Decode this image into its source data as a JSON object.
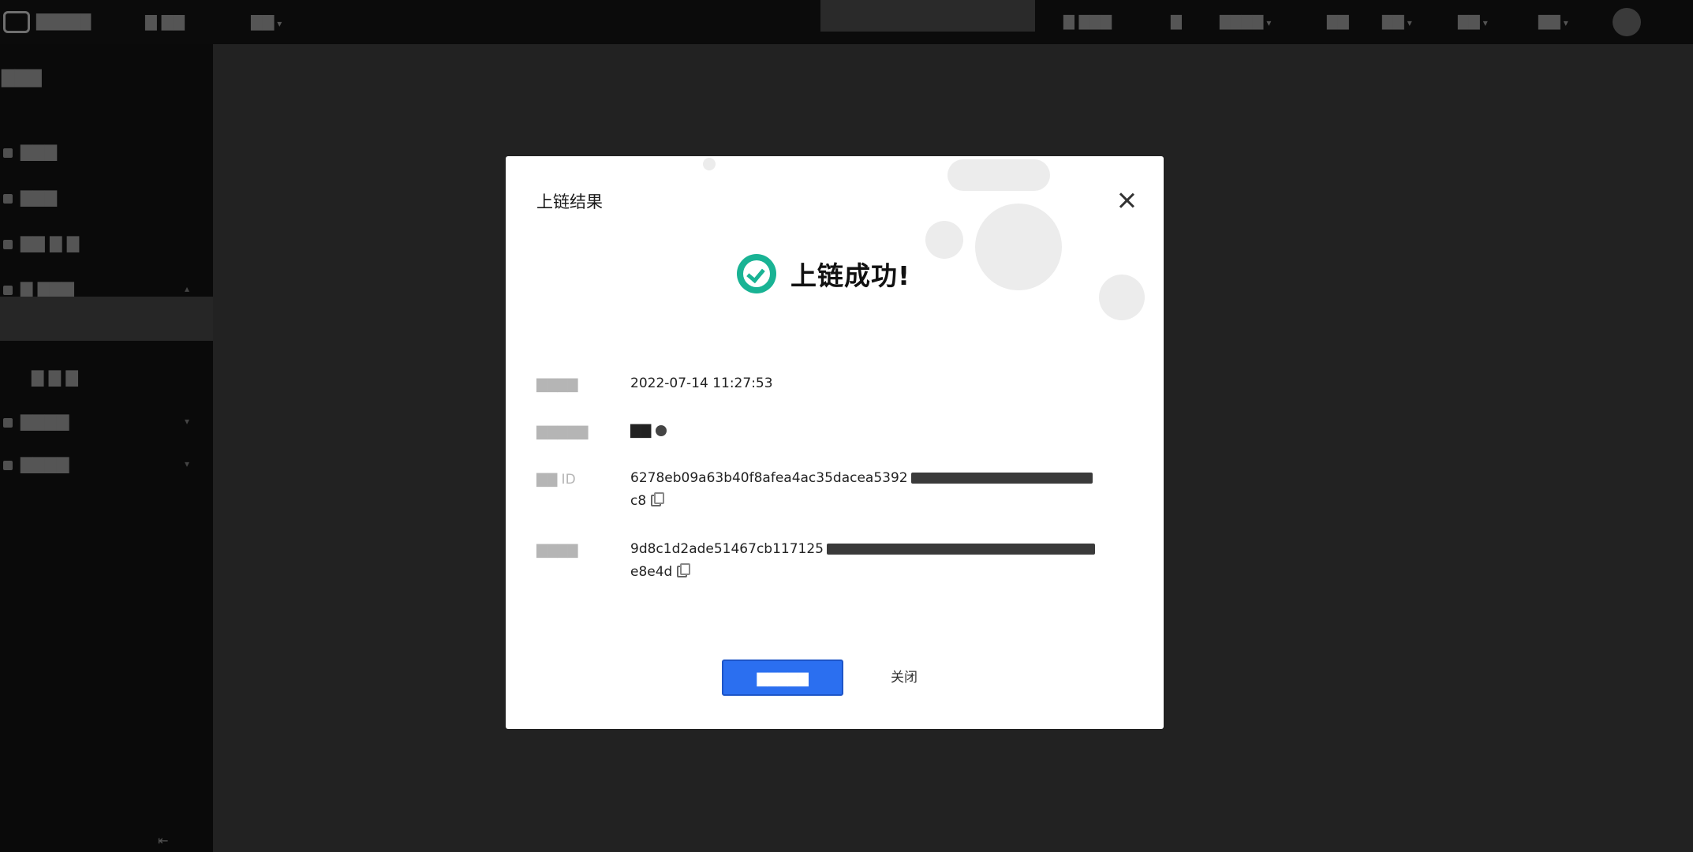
{
  "topbar": {
    "logo_text": "█████",
    "nav": [
      {
        "label": "▇ ▇▇"
      },
      {
        "label": "▇▇"
      }
    ],
    "right_items": [
      {
        "label": "▇ ▇▇▇"
      },
      {
        "label": "▇"
      },
      {
        "label": "▇▇▇▇"
      },
      {
        "label": "▇▇"
      },
      {
        "label": "▇▇"
      },
      {
        "label": "▇▇"
      },
      {
        "label": "▇▇"
      }
    ]
  },
  "sidebar": {
    "title": "▇▇▇",
    "items": [
      {
        "label": "▇▇▇"
      },
      {
        "label": "▇▇▇"
      },
      {
        "label": "▇▇ ▇ ▇"
      },
      {
        "label": "▇ ▇▇▇"
      },
      {
        "label": ""
      },
      {
        "label": "▇ ▇ ▇"
      },
      {
        "label": "▇▇▇▇"
      },
      {
        "label": "▇▇▇▇"
      }
    ]
  },
  "modal": {
    "title": "上链结果",
    "success_text": "上链成功!",
    "rows": [
      {
        "label": "▇▇▇▇",
        "value": "2022-07-14 11:27:53"
      },
      {
        "label": "▇▇▇▇▇",
        "value": "▇▇"
      },
      {
        "label": "▇▇ ID",
        "value": "6278eb09a63b40f8afea4ac35dacea5392",
        "value_tail": "c8"
      },
      {
        "label": "▇▇▇▇",
        "value": "9d8c1d2ade51467cb117125",
        "value_tail": "e8e4d"
      }
    ],
    "primary_button": "▇▇▇▇▇",
    "close_button": "关闭"
  },
  "colors": {
    "success": "#19b394",
    "primary": "#2b6ff0"
  }
}
